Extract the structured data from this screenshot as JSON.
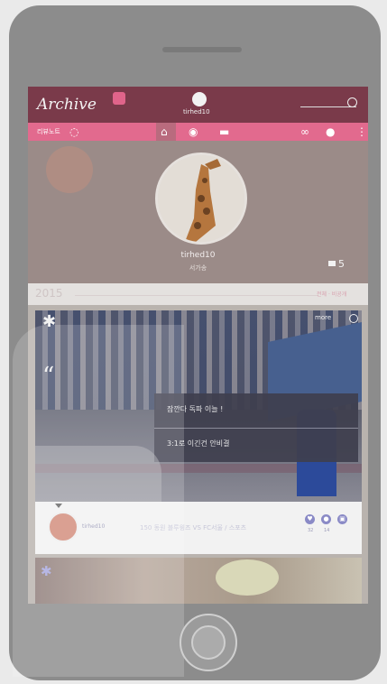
{
  "app": {
    "logo": "Archive",
    "username_top": "tirhed10"
  },
  "nav": {
    "left_label": "리뷰노트",
    "icons": [
      "home-icon",
      "compass-icon",
      "message-icon",
      "link-icon",
      "bulb-icon",
      "more-vert-icon"
    ]
  },
  "profile": {
    "name": "tirhed10",
    "subtitle": "서가송",
    "folder_count": "5"
  },
  "timeline": {
    "year": "2015",
    "links": "전체 · 비공개"
  },
  "post": {
    "more_label": "more",
    "quote_mark": "“",
    "dialog_line1": "잠깐다 독파 이늘 !",
    "dialog_line2": "3:1로 이긴건 안비결",
    "author": "tirhed10",
    "title": "150 동원 블루윙즈 VS FC서울 / 스포츠",
    "actions": [
      {
        "icon": "heart-icon",
        "count": "32"
      },
      {
        "icon": "comment-icon",
        "count": "14"
      },
      {
        "icon": "share-icon",
        "count": ""
      }
    ]
  },
  "colors": {
    "topbar": "#7a3a4a",
    "accent_pink": "#e26a8e",
    "action_purple": "#8a8ac6"
  }
}
